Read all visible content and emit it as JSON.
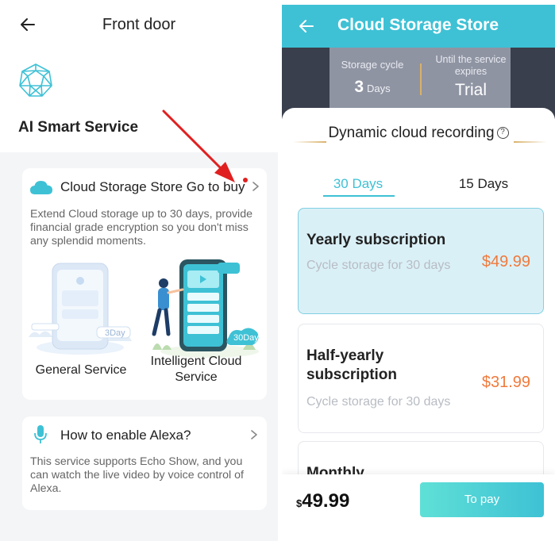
{
  "left": {
    "header": {
      "title": "Front door"
    },
    "section_title": "AI Smart Service",
    "card1": {
      "title": "Cloud Storage Store",
      "action": "Go to buy",
      "description": "Extend Cloud storage up to 30 days, provide financial grade encryption so you don't miss any splendid moments.",
      "general_label": "General Service",
      "general_badge": "3Day",
      "intelligent_label": "Intelligent Cloud Service",
      "intelligent_badge": "30Day"
    },
    "card2": {
      "title": "How to enable Alexa?",
      "description": "This service supports Echo Show, and you can watch the live video by voice control of Alexa."
    }
  },
  "right": {
    "header": {
      "title": "Cloud Storage Store"
    },
    "hero": {
      "cycle_label": "Storage cycle",
      "cycle_value": "3",
      "cycle_unit": "Days",
      "expiry_label": "Until the service expires",
      "expiry_value": "Trial"
    },
    "sheet_title": "Dynamic cloud recording",
    "tabs": [
      {
        "label": "30 Days",
        "active": true
      },
      {
        "label": "15 Days",
        "active": false
      }
    ],
    "plans": [
      {
        "name": "Yearly subscription",
        "sub": "Cycle storage for 30 days",
        "price": "$49.99",
        "selected": true
      },
      {
        "name": "Half-yearly subscription",
        "sub": "Cycle storage for 30 days",
        "price": "$31.99",
        "selected": false
      },
      {
        "name": "Monthly",
        "sub": "",
        "price": "",
        "selected": false
      }
    ],
    "footer": {
      "currency": "$",
      "total": "49.99",
      "pay_label": "To pay"
    }
  },
  "colors": {
    "accent": "#3ec1d5",
    "price": "#f07a3c",
    "annotation_arrow": "#e02020",
    "gold": "#d9b26a"
  }
}
